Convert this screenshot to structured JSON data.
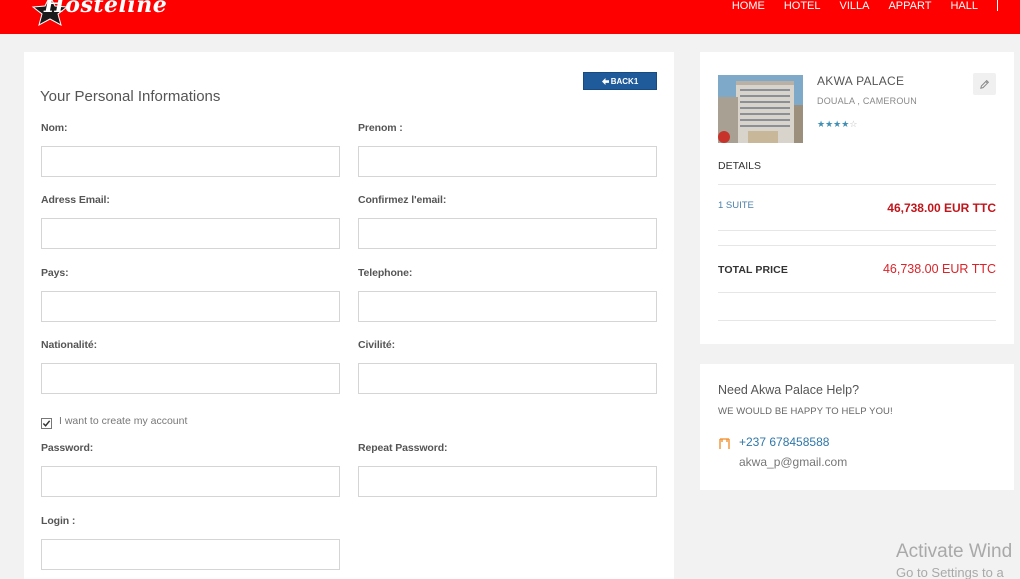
{
  "brand": {
    "name": "Hosteline",
    "color": "#fe0000"
  },
  "nav": {
    "items": [
      "HOME",
      "HOTEL",
      "VILLA",
      "APPART",
      "HALL"
    ]
  },
  "form": {
    "back_label": "BACK1",
    "title": "Your Personal Informations",
    "fields": {
      "nom": {
        "label": "Nom:",
        "value": ""
      },
      "prenom": {
        "label": "Prenom :",
        "value": ""
      },
      "email": {
        "label": "Adress Email:",
        "value": ""
      },
      "confirm_email": {
        "label": "Confirmez l'email:",
        "value": ""
      },
      "pays": {
        "label": "Pays:",
        "value": ""
      },
      "telephone": {
        "label": "Telephone:",
        "value": ""
      },
      "nationalite": {
        "label": "Nationalité:",
        "value": ""
      },
      "civilite": {
        "label": "Civilité:",
        "value": ""
      },
      "password": {
        "label": "Password:",
        "value": ""
      },
      "repeat_password": {
        "label": "Repeat Password:",
        "value": ""
      },
      "login": {
        "label": "Login :",
        "value": ""
      }
    },
    "create_account": {
      "label": "I want to create my account",
      "checked": true
    }
  },
  "summary": {
    "hotel_name": "AKWA PALACE",
    "location": "DOUALA , CAMEROUN",
    "rating": 4,
    "rating_max": 5,
    "details_heading": "DETAILS",
    "line_item": {
      "label": "1 SUITE",
      "price": "46,738.00 EUR TTC"
    },
    "total": {
      "label": "TOTAL PRICE",
      "price": "46,738.00 EUR TTC"
    },
    "accent_color": "#c0161b"
  },
  "help": {
    "title": "Need Akwa Palace Help?",
    "subtitle": "WE WOULD BE HAPPY TO HELP YOU!",
    "phone": "+237 678458588",
    "email": "akwa_p@gmail.com"
  },
  "watermark": {
    "line1": "Activate Wind",
    "line2": "Go to Settings to a"
  }
}
